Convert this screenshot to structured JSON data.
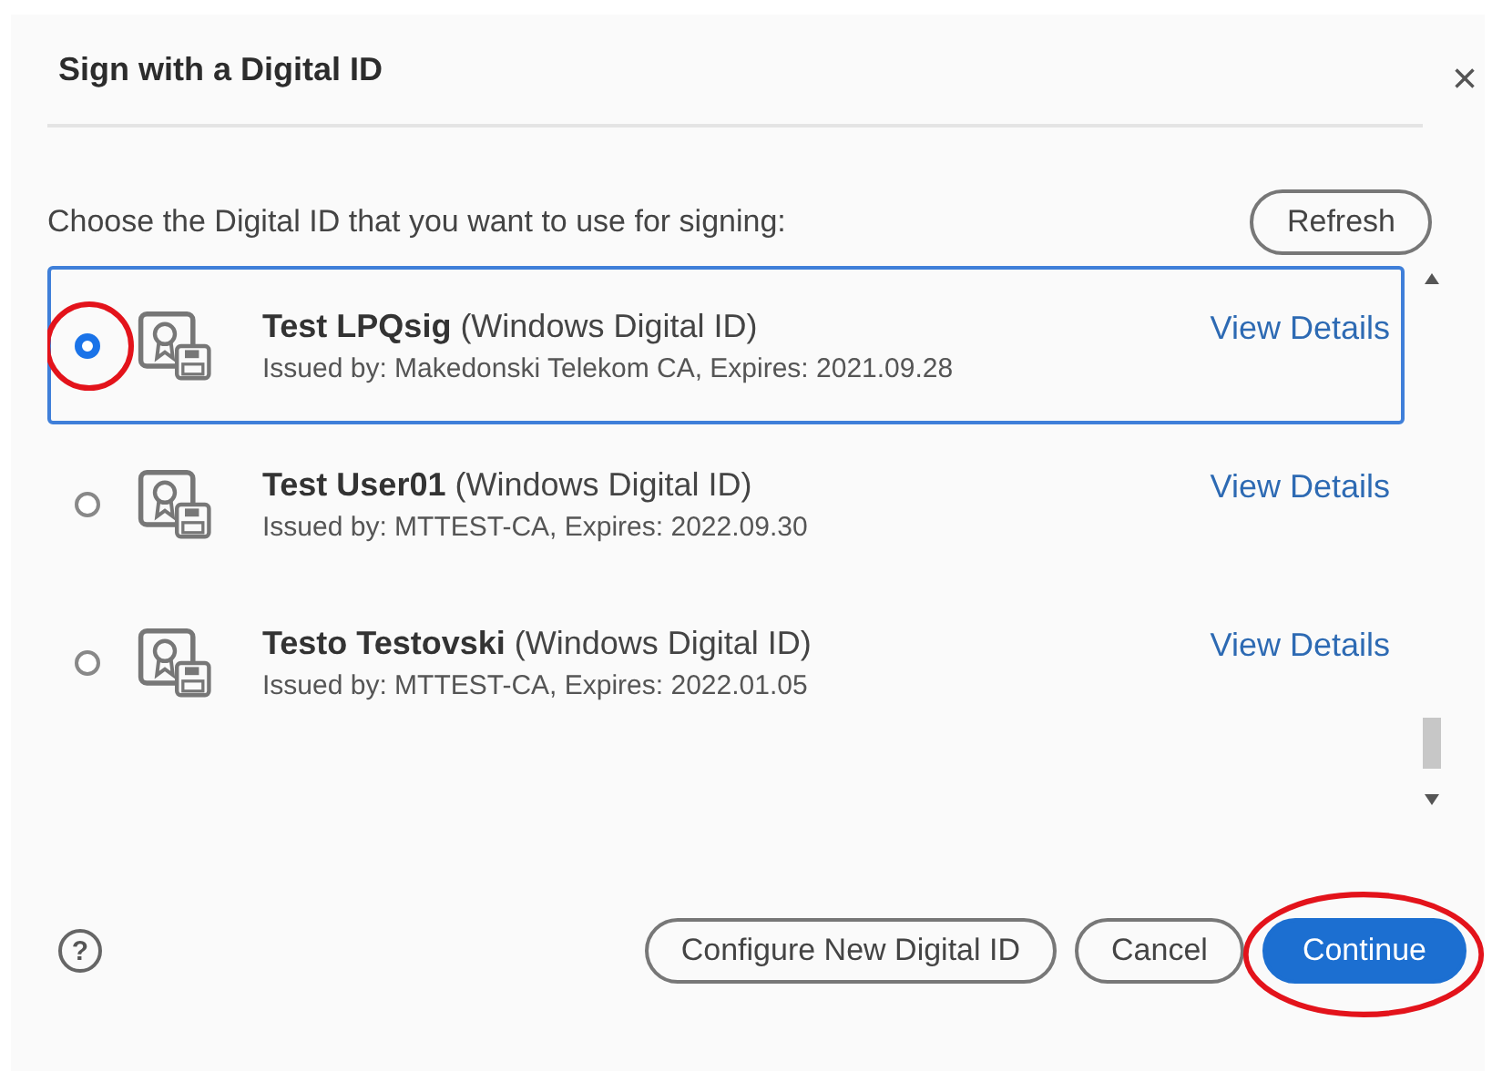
{
  "dialog": {
    "title": "Sign with a Digital ID",
    "close": "×"
  },
  "prompt": "Choose the Digital ID that you want to use for signing:",
  "refresh_button": "Refresh",
  "ids": [
    {
      "name": "Test LPQsig",
      "type": "(Windows Digital ID)",
      "issued": "Issued by: Makedonski Telekom CA, Expires: 2021.09.28",
      "link": "View Details",
      "selected": true,
      "annotated": true
    },
    {
      "name": "Test User01",
      "type": "(Windows Digital ID)",
      "issued": "Issued by: MTTEST-CA, Expires: 2022.09.30",
      "link": "View Details",
      "selected": false,
      "annotated": false
    },
    {
      "name": "Testo Testovski",
      "type": "(Windows Digital ID)",
      "issued": "Issued by: MTTEST-CA, Expires: 2022.01.05",
      "link": "View Details",
      "selected": false,
      "annotated": false
    }
  ],
  "footer": {
    "help": "?",
    "buttons": [
      {
        "label": "Configure New Digital ID",
        "kind": "secondary",
        "annotated": false
      },
      {
        "label": "Cancel",
        "kind": "secondary",
        "annotated": false
      },
      {
        "label": "Continue",
        "kind": "primary",
        "annotated": true
      }
    ]
  }
}
